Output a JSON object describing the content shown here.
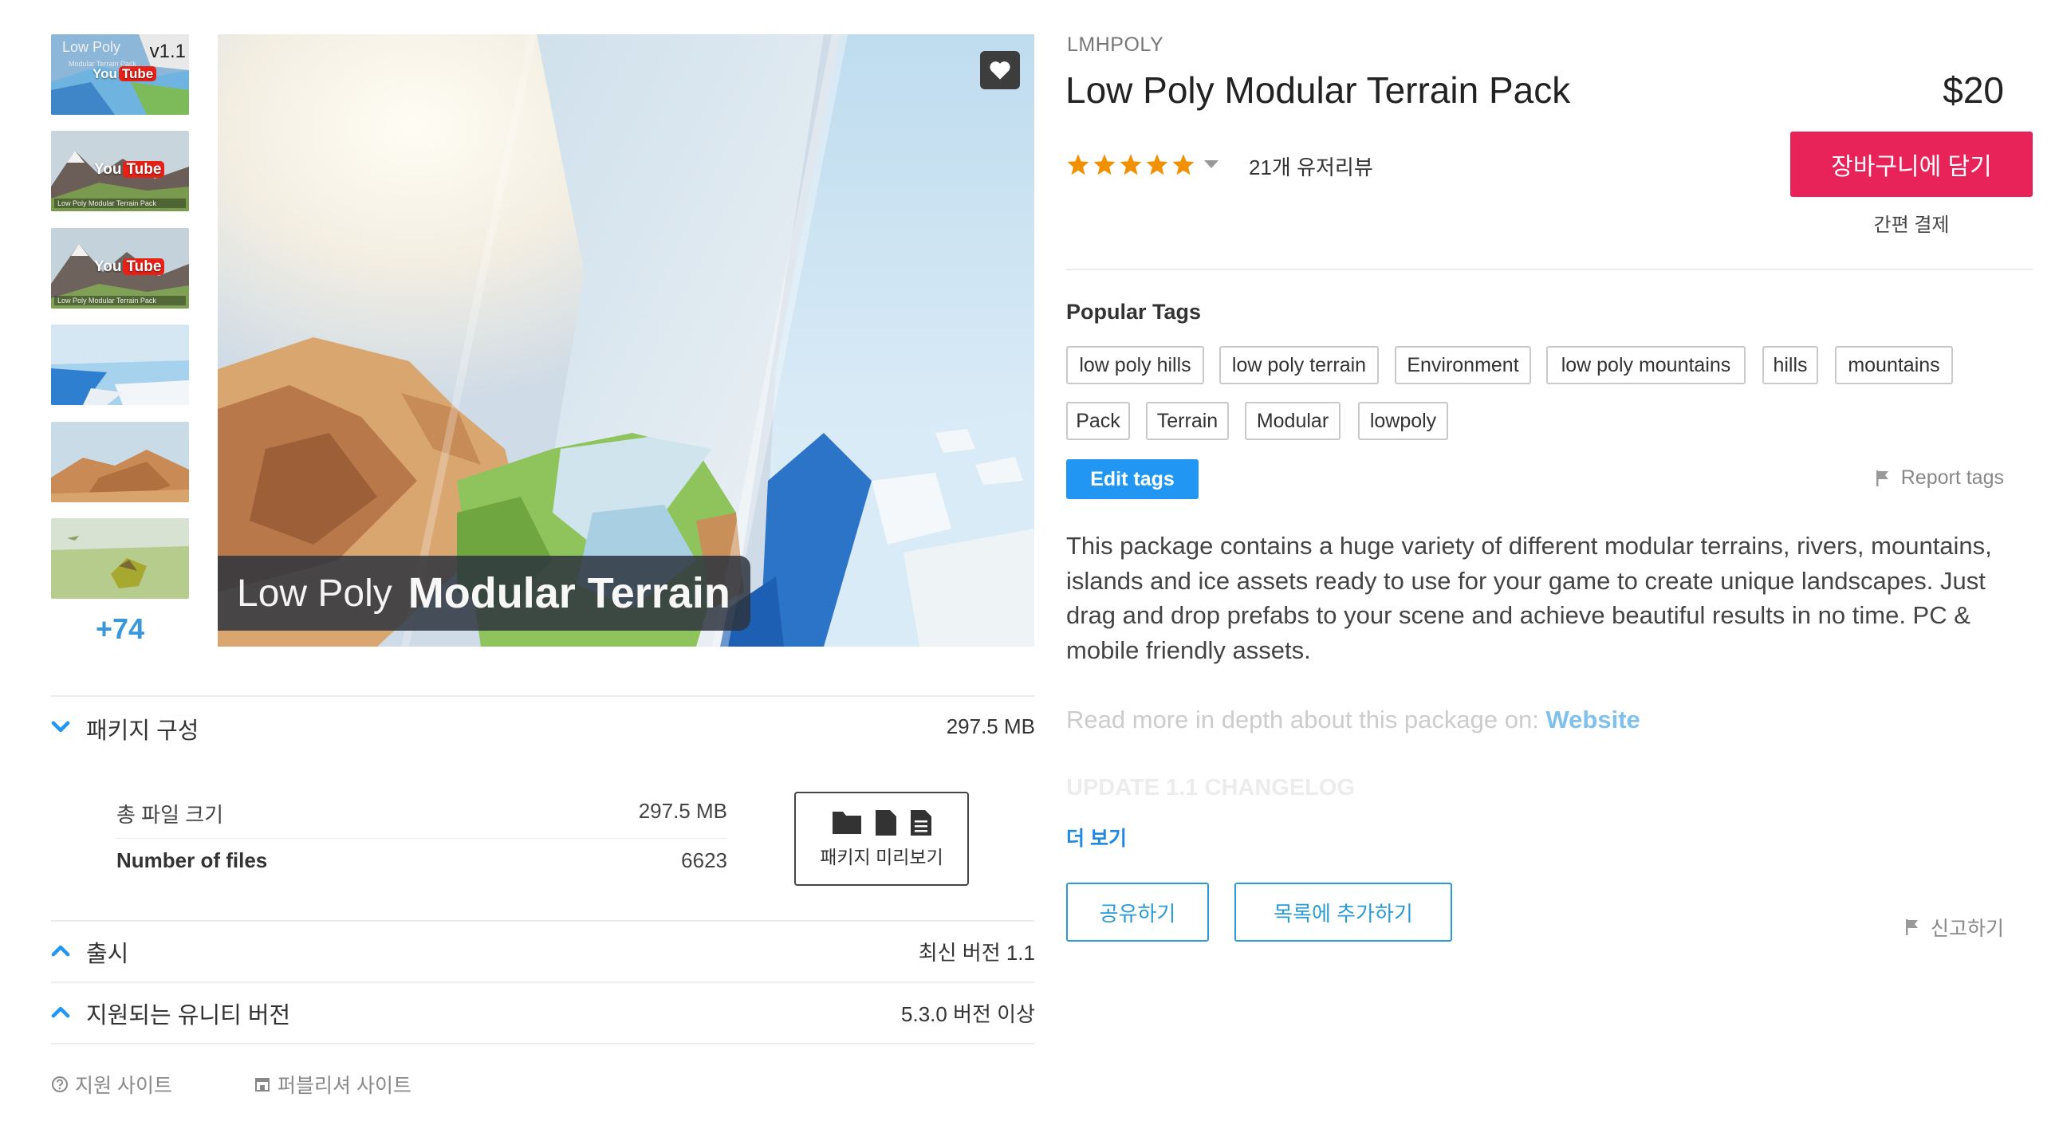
{
  "gallery": {
    "thumbnails": [
      {
        "name": "thumb-1",
        "version": "v1.1",
        "label": "Low Poly",
        "subcaption": "Modular Terrain Pack",
        "youtube": "You Tube"
      },
      {
        "name": "thumb-2",
        "youtube": "You Tube",
        "caption": "Low Poly Modular Terrain Pack"
      },
      {
        "name": "thumb-3",
        "youtube": "You Tube",
        "caption": "Low Poly Modular Terrain Pack"
      },
      {
        "name": "thumb-4"
      },
      {
        "name": "thumb-5"
      },
      {
        "name": "thumb-6"
      }
    ],
    "more_count": "+74",
    "hero_banner_light": "Low Poly",
    "hero_banner_bold": "Modular Terrain"
  },
  "package": {
    "title": "패키지 구성",
    "size": "297.5 MB",
    "rows": [
      {
        "label": "총 파일 크기",
        "value": "297.5 MB"
      },
      {
        "label": "Number of files",
        "value": "6623"
      }
    ],
    "preview_label": "패키지 미리보기"
  },
  "release": {
    "title": "출시",
    "value": "최신 버전 1.1"
  },
  "unity": {
    "title": "지원되는 유니티 버전",
    "value": "5.3.0 버전 이상"
  },
  "footer_links": {
    "support": "지원 사이트",
    "publisher": "퍼블리셔 사이트"
  },
  "product": {
    "publisher": "LMHPOLY",
    "title": "Low Poly Modular Terrain Pack",
    "price": "$20",
    "rating": 5,
    "reviews": "21개 유저리뷰",
    "cart_label": "장바구니에 담기",
    "quick_pay": "간편 결제"
  },
  "tags": {
    "heading": "Popular Tags",
    "items": [
      "low poly hills",
      "low poly terrain",
      "Environment",
      "low poly mountains",
      "hills",
      "mountains",
      "Pack",
      "Terrain",
      "Modular",
      "lowpoly"
    ],
    "edit_label": "Edit tags",
    "report_label": "Report tags"
  },
  "description": {
    "text": "This package contains a huge variety of different modular terrains, rivers, mountains, islands and ice assets ready to use for your game to create unique landscapes. Just drag and drop prefabs to your scene and achieve beautiful results in no time. PC & mobile friendly assets.",
    "read_more_prefix": "Read more in depth about this package on: ",
    "read_more_link": "Website",
    "changelog": "UPDATE 1.1 CHANGELOG",
    "see_more": "더 보기"
  },
  "actions": {
    "share": "공유하기",
    "add_to_list": "목록에 추가하기",
    "report": "신고하기"
  },
  "colors": {
    "accent_pink": "#e8235a",
    "accent_blue": "#2196f3",
    "link_blue": "#2a9bd5",
    "star": "#f29100"
  }
}
